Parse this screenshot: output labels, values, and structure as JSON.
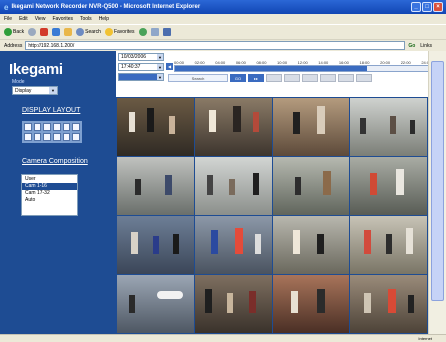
{
  "window": {
    "title": "Ikegami Network Recorder NVR-Q500 - Microsoft Internet Explorer",
    "buttons": [
      "_",
      "□",
      "×"
    ]
  },
  "menu": {
    "items": [
      "File",
      "Edit",
      "View",
      "Favorites",
      "Tools",
      "Help"
    ]
  },
  "toolbar": {
    "back": "Back",
    "search": "Search",
    "favorites": "Favorites"
  },
  "address": {
    "label": "Address",
    "url": "http://192.168.1.200/",
    "go": "Go",
    "links": "Links"
  },
  "sidebar": {
    "logo": "Ikegami",
    "mode_label": "Mode",
    "mode_value": "Display",
    "display_layout_title": "DISPLAY LAYOUT",
    "camera_composition_title": "Camera Composition",
    "camera_list": [
      "User",
      "Cam 1-16",
      "Cam 17-32",
      "Auto"
    ],
    "selected_camera_index": 1
  },
  "controls": {
    "date": "10/03/2006",
    "time": "17:40:37",
    "timeline_labels": [
      "00:00",
      "02:00",
      "04:00",
      "06:00",
      "08:00",
      "10:00",
      "12:00",
      "14:00",
      "16:00",
      "18:00",
      "20:00",
      "22:00",
      "24:00"
    ],
    "timeline_progress": 0.72,
    "search_field": "Search",
    "go_label": "GO"
  },
  "video_grid": {
    "rows": 4,
    "cols": 4,
    "cameras": [
      "cam-01",
      "cam-02",
      "cam-03",
      "cam-04",
      "cam-05",
      "cam-06",
      "cam-07",
      "cam-08",
      "cam-09",
      "cam-10",
      "cam-11",
      "cam-12",
      "cam-13",
      "cam-14",
      "cam-15",
      "cam-16"
    ]
  },
  "status": {
    "left": "",
    "zone": "Internet"
  },
  "colors": {
    "sidebar_blue": "#1e4c93",
    "titlebar_blue": "#1146b4",
    "chrome_gray": "#ece9d8"
  }
}
